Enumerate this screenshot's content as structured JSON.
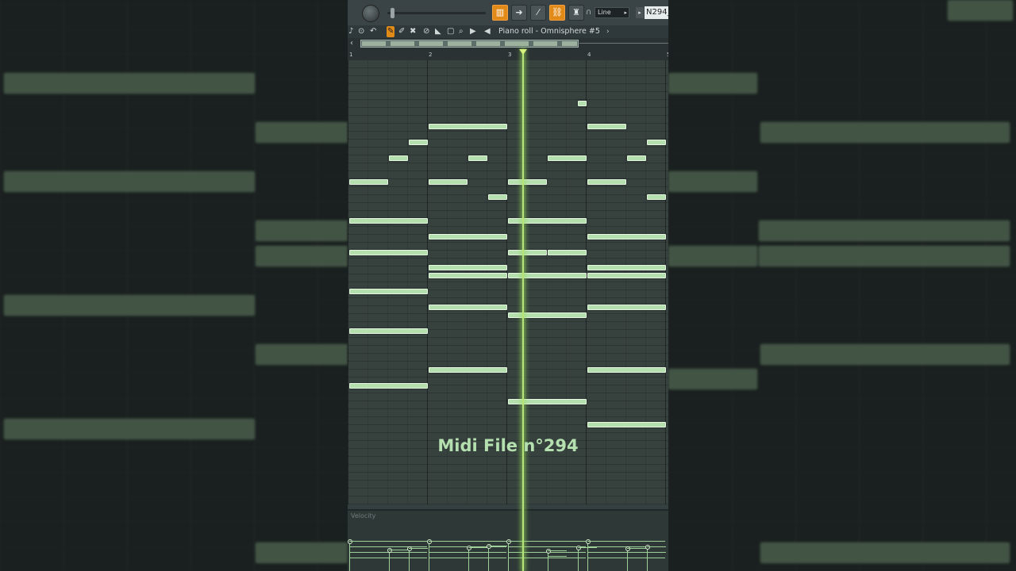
{
  "window": {
    "title": "Piano roll - Omnisphere #5",
    "snap_mode": "Line",
    "pattern_name": "N294_"
  },
  "ruler": {
    "bars": [
      "1",
      "2",
      "3",
      "4",
      "5"
    ]
  },
  "velocity_panel": {
    "label": "Velocity"
  },
  "caption": "Midi File n°294",
  "colors": {
    "note": "#b6dfb0",
    "playhead": "#b7e37a",
    "accent": "#e28a18",
    "background": "#34403f"
  },
  "icons": {
    "toolbar": [
      "piano-icon",
      "arrow-icon",
      "brush-icon",
      "link-icon",
      "stamp-icon"
    ],
    "tools": [
      "pencil-icon",
      "paint-icon",
      "erase-icon",
      "mute-icon",
      "slice-icon",
      "select-icon",
      "zoom-icon",
      "playback-icon"
    ]
  },
  "notes": [
    {
      "bar": 1.0,
      "len": 0.5,
      "row": 15
    },
    {
      "bar": 1.5,
      "len": 0.25,
      "row": 12
    },
    {
      "bar": 1.75,
      "len": 0.25,
      "row": 10
    },
    {
      "bar": 2.0,
      "len": 1.0,
      "row": 8
    },
    {
      "bar": 2.0,
      "len": 0.5,
      "row": 15
    },
    {
      "bar": 2.5,
      "len": 0.25,
      "row": 12
    },
    {
      "bar": 2.75,
      "len": 0.25,
      "row": 17
    },
    {
      "bar": 3.0,
      "len": 0.5,
      "row": 15
    },
    {
      "bar": 3.5,
      "len": 0.5,
      "row": 12
    },
    {
      "bar": 3.88,
      "len": 0.12,
      "row": 5
    },
    {
      "bar": 4.0,
      "len": 0.5,
      "row": 8
    },
    {
      "bar": 4.0,
      "len": 0.5,
      "row": 15
    },
    {
      "bar": 4.5,
      "len": 0.25,
      "row": 12
    },
    {
      "bar": 4.75,
      "len": 0.25,
      "row": 10
    },
    {
      "bar": 4.75,
      "len": 0.25,
      "row": 17
    },
    {
      "bar": 1.0,
      "len": 1.0,
      "row": 20
    },
    {
      "bar": 1.0,
      "len": 1.0,
      "row": 24
    },
    {
      "bar": 1.0,
      "len": 1.0,
      "row": 29
    },
    {
      "bar": 1.0,
      "len": 1.0,
      "row": 34
    },
    {
      "bar": 1.0,
      "len": 1.0,
      "row": 41
    },
    {
      "bar": 2.0,
      "len": 1.0,
      "row": 22
    },
    {
      "bar": 2.0,
      "len": 1.0,
      "row": 26
    },
    {
      "bar": 2.0,
      "len": 1.0,
      "row": 27
    },
    {
      "bar": 2.0,
      "len": 1.0,
      "row": 31
    },
    {
      "bar": 2.0,
      "len": 1.0,
      "row": 39
    },
    {
      "bar": 3.0,
      "len": 1.0,
      "row": 20
    },
    {
      "bar": 3.0,
      "len": 0.5,
      "row": 24
    },
    {
      "bar": 3.5,
      "len": 0.5,
      "row": 24
    },
    {
      "bar": 3.0,
      "len": 1.0,
      "row": 27
    },
    {
      "bar": 3.0,
      "len": 1.0,
      "row": 32
    },
    {
      "bar": 3.0,
      "len": 1.0,
      "row": 43
    },
    {
      "bar": 4.0,
      "len": 1.0,
      "row": 22
    },
    {
      "bar": 4.0,
      "len": 1.0,
      "row": 26
    },
    {
      "bar": 4.0,
      "len": 1.0,
      "row": 27
    },
    {
      "bar": 4.0,
      "len": 1.0,
      "row": 31
    },
    {
      "bar": 4.0,
      "len": 1.0,
      "row": 39
    },
    {
      "bar": 4.0,
      "len": 1.0,
      "row": 46
    }
  ],
  "playhead_bar": 3.18
}
